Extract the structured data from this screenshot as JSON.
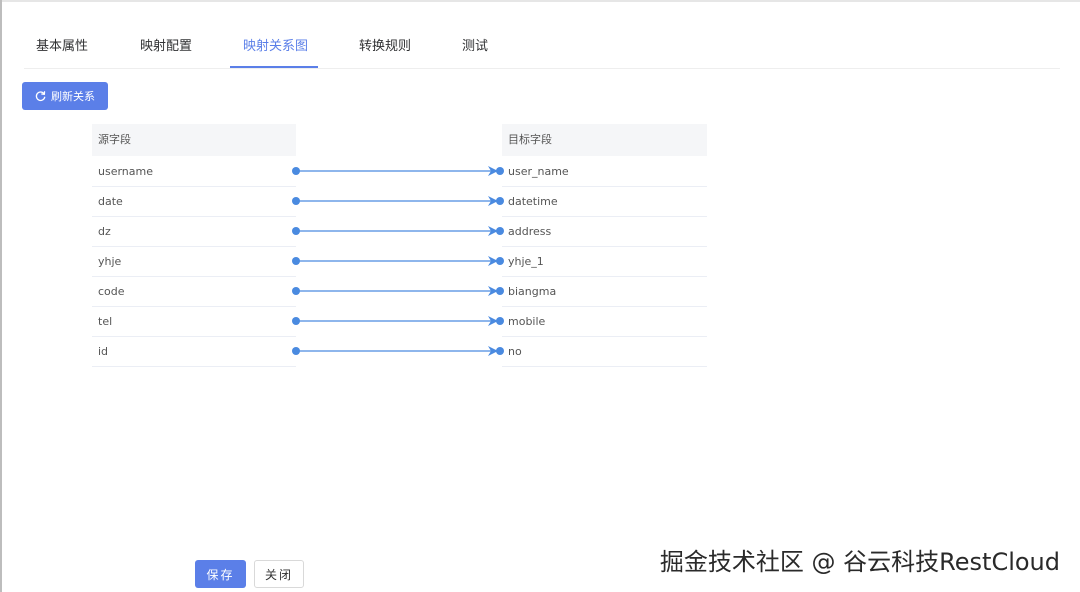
{
  "tabs": [
    {
      "label": "基本属性",
      "active": false
    },
    {
      "label": "映射配置",
      "active": false
    },
    {
      "label": "映射关系图",
      "active": true
    },
    {
      "label": "转换规则",
      "active": false
    },
    {
      "label": "测试",
      "active": false
    }
  ],
  "toolbar": {
    "refresh_label": "刷新关系",
    "refresh_icon": "refresh-icon"
  },
  "source": {
    "header": "源字段",
    "fields": [
      "username",
      "date",
      "dz",
      "yhje",
      "code",
      "tel",
      "id"
    ]
  },
  "target": {
    "header": "目标字段",
    "fields": [
      "user_name",
      "datetime",
      "address",
      "yhje_1",
      "biangma",
      "mobile",
      "no"
    ]
  },
  "mappings": [
    [
      0,
      0
    ],
    [
      1,
      1
    ],
    [
      2,
      2
    ],
    [
      3,
      3
    ],
    [
      4,
      4
    ],
    [
      5,
      5
    ],
    [
      6,
      6
    ]
  ],
  "footer": {
    "save_label": "保存",
    "close_label": "关闭"
  },
  "watermark": "掘金技术社区 @ 谷云科技RestCloud",
  "colors": {
    "accent": "#5b7fe8",
    "link": "#4a8ae0"
  }
}
